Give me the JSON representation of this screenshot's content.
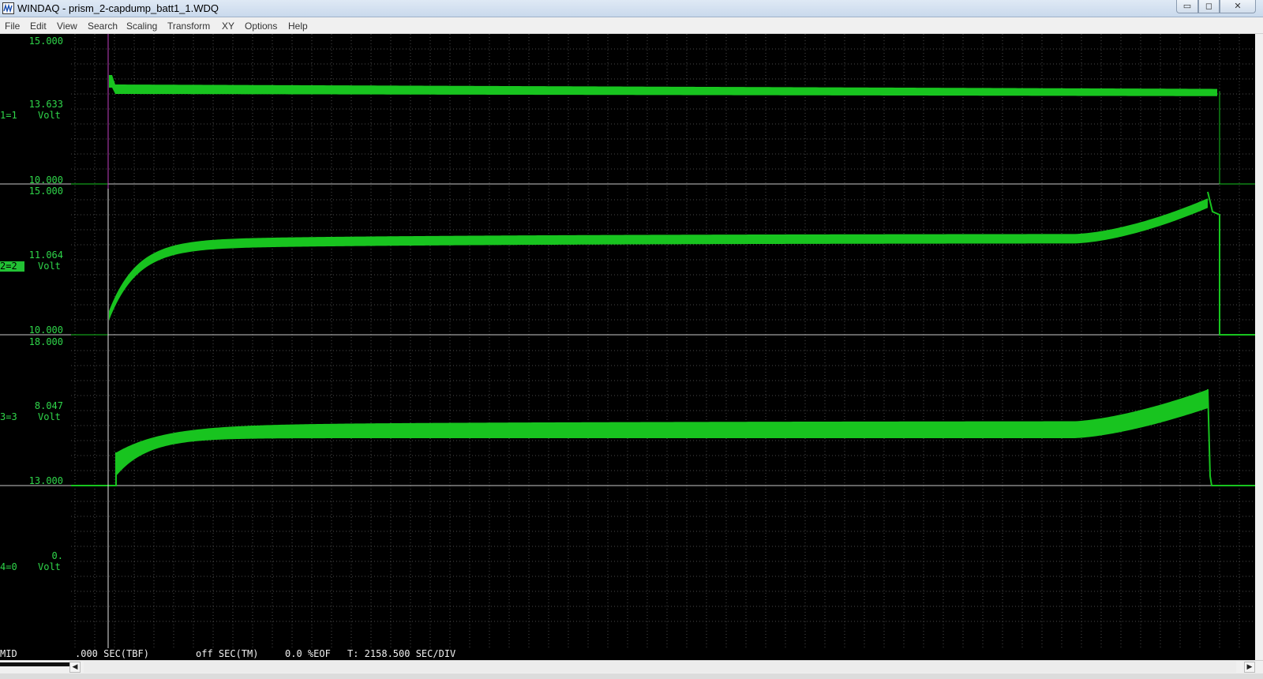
{
  "window": {
    "title": "WINDAQ - prism_2-capdump_batt1_1.WDQ",
    "controls": {
      "minimize": "▭",
      "maximize": "◻",
      "close": "✕"
    }
  },
  "menu": [
    "File",
    "Edit",
    "View",
    "Search",
    "Scaling",
    "Transform",
    "XY",
    "Options",
    "Help"
  ],
  "channels": [
    {
      "id": "1=1",
      "unit": "Volt",
      "top": "15.000",
      "mid": "13.633",
      "bottom": "10.000",
      "active": false
    },
    {
      "id": "2=2",
      "unit": "Volt",
      "top": "15.000",
      "mid": "11.064",
      "bottom": "10.000",
      "active": true
    },
    {
      "id": "3=3",
      "unit": "Volt",
      "top": "18.000",
      "mid": "8.047",
      "bottom": "13.000",
      "active": false
    },
    {
      "id": "4=0",
      "unit": "Volt",
      "top": "",
      "mid": "0.",
      "bottom": "",
      "active": false
    }
  ],
  "status": {
    "mode": "MID",
    "tbf": ".000 SEC(TBF)",
    "tm": "off SEC(TM)",
    "eof": "0.0 %EOF",
    "div": "T: 2158.500 SEC/DIV"
  },
  "scrollbar": {
    "left_arrow": "◀",
    "right_arrow": "▶"
  },
  "colors": {
    "trace": "#18c41f",
    "grid": "#4a4a4a",
    "label": "#2fd64a",
    "cursor": "#c040c0",
    "separator": "#c8c8c8"
  }
}
